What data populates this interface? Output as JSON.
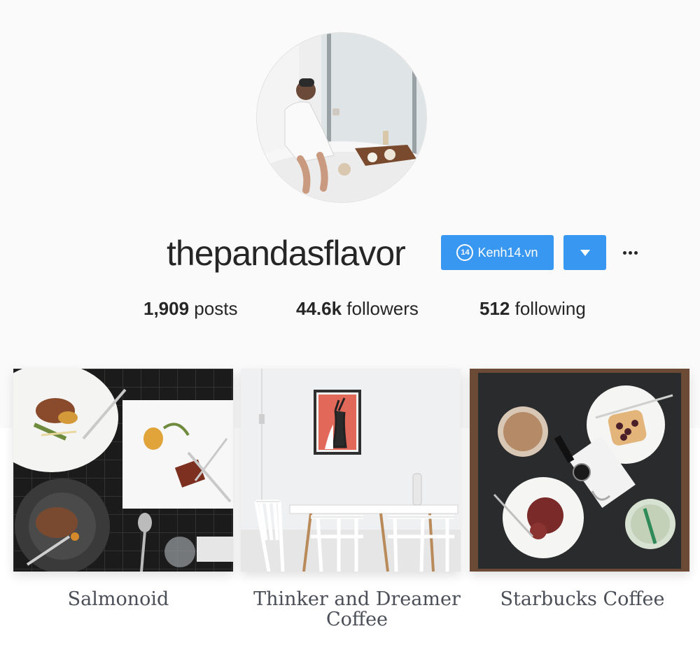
{
  "profile": {
    "username": "thepandasflavor",
    "follow_button_label": "Kenh14.vn",
    "follow_button_logo": "14",
    "accent_color": "#3897f0"
  },
  "stats": {
    "posts_count": "1,909",
    "posts_label": " posts",
    "followers_count": "44.6k",
    "followers_label": " followers",
    "following_count": "512",
    "following_label": " following"
  },
  "posts": [
    {
      "caption": "Salmonoid"
    },
    {
      "caption": "Thinker and Dreamer Coffee"
    },
    {
      "caption": "Starbucks Coffee"
    }
  ]
}
